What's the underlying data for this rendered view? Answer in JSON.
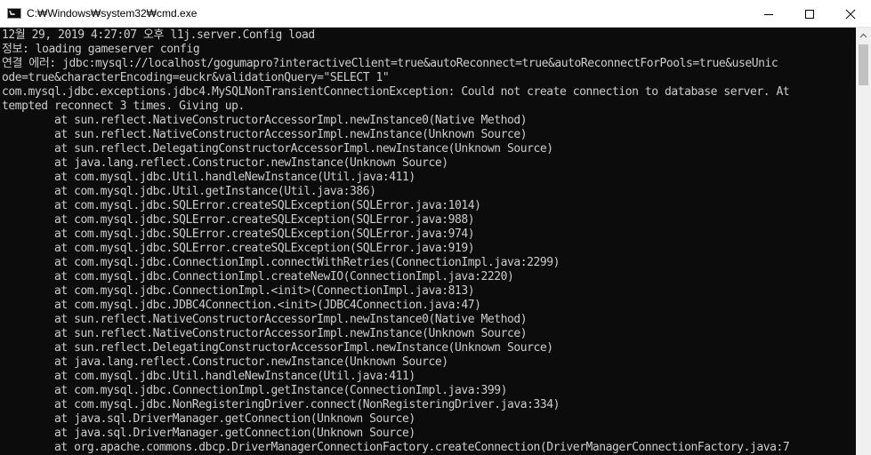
{
  "window": {
    "title": "C:₩Windows₩system32₩cmd.exe",
    "icon": "cmd-icon",
    "controls": [
      "minimize-icon",
      "maximize-icon",
      "close-icon"
    ]
  },
  "colors": {
    "console_background": "#0c0c0c",
    "console_text": "#cccccc",
    "titlebar_background": "#ffffff",
    "scrollbar_track": "#f0f0f0",
    "scrollbar_thumb": "#c1c1c1"
  },
  "console": {
    "lines": [
      "12월 29, 2019 4:27:07 오후 l1j.server.Config load",
      "정보: loading gameserver config",
      "연결 에러: jdbc:mysql://localhost/gogumapro?interactiveClient=true&autoReconnect=true&autoReconnectForPools=true&useUnic",
      "ode=true&characterEncoding=euckr&validationQuery=\"SELECT 1\"",
      "com.mysql.jdbc.exceptions.jdbc4.MySQLNonTransientConnectionException: Could not create connection to database server. At",
      "tempted reconnect 3 times. Giving up.",
      "        at sun.reflect.NativeConstructorAccessorImpl.newInstance0(Native Method)",
      "        at sun.reflect.NativeConstructorAccessorImpl.newInstance(Unknown Source)",
      "        at sun.reflect.DelegatingConstructorAccessorImpl.newInstance(Unknown Source)",
      "        at java.lang.reflect.Constructor.newInstance(Unknown Source)",
      "        at com.mysql.jdbc.Util.handleNewInstance(Util.java:411)",
      "        at com.mysql.jdbc.Util.getInstance(Util.java:386)",
      "        at com.mysql.jdbc.SQLError.createSQLException(SQLError.java:1014)",
      "        at com.mysql.jdbc.SQLError.createSQLException(SQLError.java:988)",
      "        at com.mysql.jdbc.SQLError.createSQLException(SQLError.java:974)",
      "        at com.mysql.jdbc.SQLError.createSQLException(SQLError.java:919)",
      "        at com.mysql.jdbc.ConnectionImpl.connectWithRetries(ConnectionImpl.java:2299)",
      "        at com.mysql.jdbc.ConnectionImpl.createNewIO(ConnectionImpl.java:2220)",
      "        at com.mysql.jdbc.ConnectionImpl.<init>(ConnectionImpl.java:813)",
      "        at com.mysql.jdbc.JDBC4Connection.<init>(JDBC4Connection.java:47)",
      "        at sun.reflect.NativeConstructorAccessorImpl.newInstance0(Native Method)",
      "        at sun.reflect.NativeConstructorAccessorImpl.newInstance(Unknown Source)",
      "        at sun.reflect.DelegatingConstructorAccessorImpl.newInstance(Unknown Source)",
      "        at java.lang.reflect.Constructor.newInstance(Unknown Source)",
      "        at com.mysql.jdbc.Util.handleNewInstance(Util.java:411)",
      "        at com.mysql.jdbc.ConnectionImpl.getInstance(ConnectionImpl.java:399)",
      "        at com.mysql.jdbc.NonRegisteringDriver.connect(NonRegisteringDriver.java:334)",
      "        at java.sql.DriverManager.getConnection(Unknown Source)",
      "        at java.sql.DriverManager.getConnection(Unknown Source)",
      "        at org.apache.commons.dbcp.DriverManagerConnectionFactory.createConnection(DriverManagerConnectionFactory.java:7"
    ]
  }
}
